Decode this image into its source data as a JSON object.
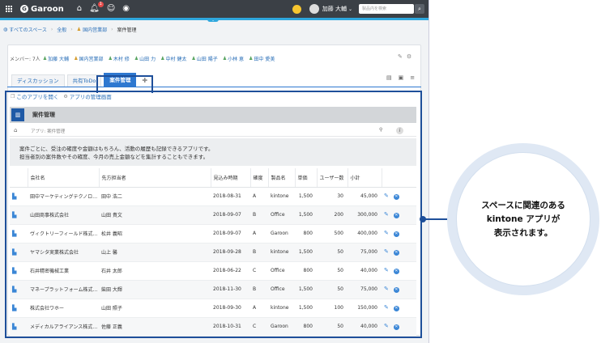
{
  "topbar": {
    "logo": "Garoon",
    "notification_count": "1",
    "user_name": "加藤 大輔",
    "search_placeholder": "製品内を検索"
  },
  "breadcrumb": [
    "すべてのスペース",
    "全般",
    "国内営業部",
    "案件管理"
  ],
  "members": {
    "label": "メンバー: 7人",
    "names": [
      "加藤 大輔",
      "国内営業部",
      "木村 修",
      "山田 力",
      "中村 健太",
      "山田 陽子",
      "小林 恵",
      "田中 愛美"
    ]
  },
  "tabs": [
    {
      "label": "ディスカッション"
    },
    {
      "label": "共有ToDo"
    },
    {
      "label": "案件管理"
    }
  ],
  "app_links": {
    "open": "このアプリを開く",
    "manage": "アプリの管理画面"
  },
  "app": {
    "title": "案件管理",
    "crumb": "アプリ: 案件管理",
    "desc1": "案件ごとに、受注の確度や金額はもちろん、活動の履歴も記録できるアプリです。",
    "desc2": "担当者別の案件数やその確度、今月の売上金額などを集計することもできます。"
  },
  "table": {
    "headers": [
      "会社名",
      "先方担当者",
      "見込み時期",
      "確度",
      "製品名",
      "単価",
      "ユーザー数",
      "小計"
    ],
    "rows": [
      {
        "company": "田中マーケティングテクノロジー",
        "contact": "田中 浩二",
        "date": "2018-08-31",
        "rank": "A",
        "product": "kintone",
        "price": "1,500",
        "users": "30",
        "subtotal": "45,000"
      },
      {
        "company": "山田商事株式会社",
        "contact": "山田 貴文",
        "date": "2018-09-07",
        "rank": "B",
        "product": "Office",
        "price": "1,500",
        "users": "200",
        "subtotal": "300,000"
      },
      {
        "company": "ヴィクトリーフィールド株式会社",
        "contact": "松井 義昭",
        "date": "2018-09-07",
        "rank": "A",
        "product": "Garoon",
        "price": "800",
        "users": "500",
        "subtotal": "400,000"
      },
      {
        "company": "ヤマシタ実業株式会社",
        "contact": "山上 馨",
        "date": "2018-09-28",
        "rank": "B",
        "product": "kintone",
        "price": "1,500",
        "users": "50",
        "subtotal": "75,000"
      },
      {
        "company": "石井精密機械工業",
        "contact": "石井 太郎",
        "date": "2018-06-22",
        "rank": "C",
        "product": "Office",
        "price": "800",
        "users": "50",
        "subtotal": "40,000"
      },
      {
        "company": "マネープラットフォーム株式会社",
        "contact": "柴田 大輝",
        "date": "2018-11-30",
        "rank": "B",
        "product": "Office",
        "price": "1,500",
        "users": "50",
        "subtotal": "75,000"
      },
      {
        "company": "株式会社ワホー",
        "contact": "山田 照子",
        "date": "2018-09-30",
        "rank": "A",
        "product": "kintone",
        "price": "1,500",
        "users": "100",
        "subtotal": "150,000"
      },
      {
        "company": "メディカルアライアンス株式会社",
        "contact": "佐藤 正義",
        "date": "2018-10-31",
        "rank": "C",
        "product": "Garoon",
        "price": "800",
        "users": "50",
        "subtotal": "40,000"
      }
    ]
  },
  "callout": {
    "line1": "スペースに関連のある",
    "line2": "kintone アプリが",
    "line3": "表示されます。"
  }
}
